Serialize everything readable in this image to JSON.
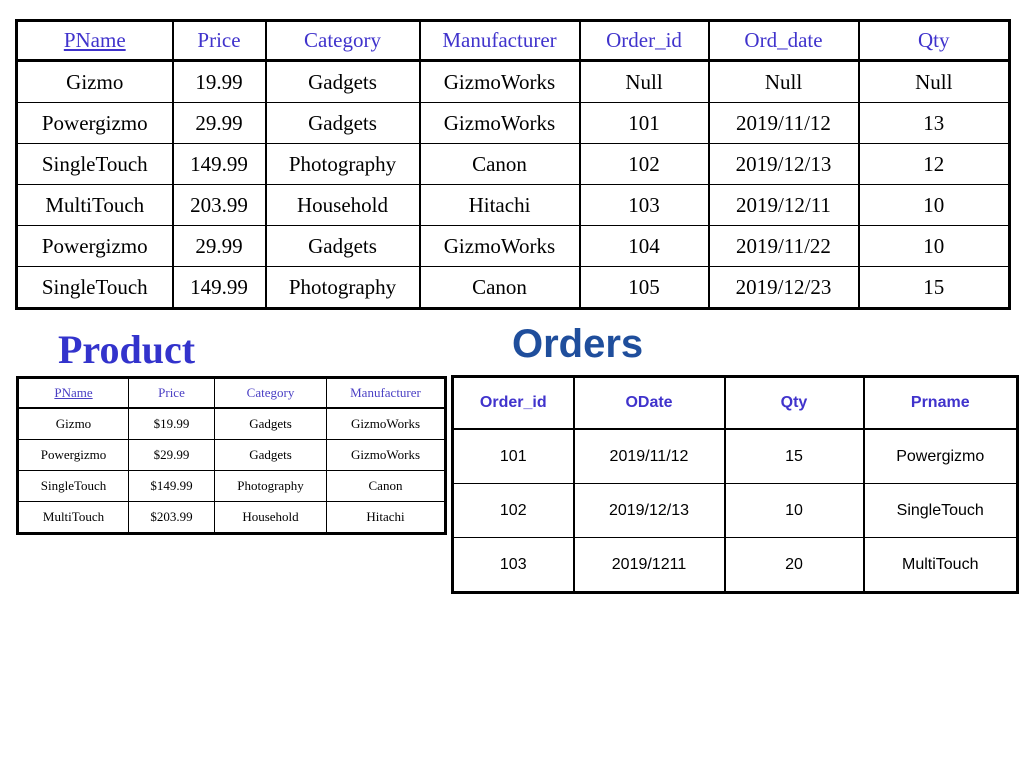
{
  "colors": {
    "join_header": "#4033CC",
    "product_title": "#3333CC",
    "product_header": "#4A3FC4",
    "orders_title": "#1F4E9C",
    "orders_header": "#4033CC",
    "text": "#000000",
    "border": "#000000",
    "background": "#ffffff"
  },
  "join_table": {
    "columns": [
      {
        "label": "PName",
        "underlined": true
      },
      {
        "label": "Price",
        "underlined": false
      },
      {
        "label": "Category",
        "underlined": false
      },
      {
        "label": "Manufacturer",
        "underlined": false
      },
      {
        "label": "Order_id",
        "underlined": false
      },
      {
        "label": "Ord_date",
        "underlined": false
      },
      {
        "label": "Qty",
        "underlined": false
      }
    ],
    "rows": [
      [
        "Gizmo",
        "19.99",
        "Gadgets",
        "GizmoWorks",
        "Null",
        "Null",
        "Null"
      ],
      [
        "Powergizmo",
        "29.99",
        "Gadgets",
        "GizmoWorks",
        "101",
        "2019/11/12",
        "13"
      ],
      [
        "SingleTouch",
        "149.99",
        "Photography",
        "Canon",
        "102",
        "2019/12/13",
        "12"
      ],
      [
        "MultiTouch",
        "203.99",
        "Household",
        "Hitachi",
        "103",
        "2019/12/11",
        "10"
      ],
      [
        "Powergizmo",
        "29.99",
        "Gadgets",
        "GizmoWorks",
        "104",
        "2019/11/22",
        "10"
      ],
      [
        "SingleTouch",
        "149.99",
        "Photography",
        "Canon",
        "105",
        "2019/12/23",
        "15"
      ]
    ]
  },
  "product": {
    "title": "Product",
    "columns": [
      {
        "label": "PName",
        "underlined": true
      },
      {
        "label": "Price",
        "underlined": false
      },
      {
        "label": "Category",
        "underlined": false
      },
      {
        "label": "Manufacturer",
        "underlined": false
      }
    ],
    "rows": [
      [
        "Gizmo",
        "$19.99",
        "Gadgets",
        "GizmoWorks"
      ],
      [
        "Powergizmo",
        "$29.99",
        "Gadgets",
        "GizmoWorks"
      ],
      [
        "SingleTouch",
        "$149.99",
        "Photography",
        "Canon"
      ],
      [
        "MultiTouch",
        "$203.99",
        "Household",
        "Hitachi"
      ]
    ]
  },
  "orders": {
    "title": "Orders",
    "columns": [
      {
        "label": "Order_id",
        "underlined": false
      },
      {
        "label": "ODate",
        "underlined": false
      },
      {
        "label": "Qty",
        "underlined": false
      },
      {
        "label": "Prname",
        "underlined": false
      }
    ],
    "rows": [
      [
        "101",
        "2019/11/12",
        "15",
        "Powergizmo"
      ],
      [
        "102",
        "2019/12/13",
        "10",
        "SingleTouch"
      ],
      [
        "103",
        "2019/1211",
        "20",
        "MultiTouch"
      ]
    ]
  }
}
